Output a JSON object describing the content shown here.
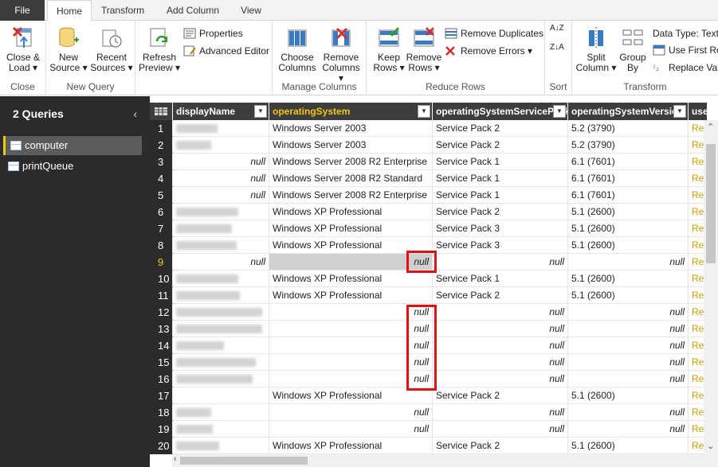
{
  "tabs": [
    "File",
    "Home",
    "Transform",
    "Add Column",
    "View"
  ],
  "ribbon": {
    "close": {
      "close_load": [
        "Close &",
        "Load ▾"
      ],
      "label": "Close"
    },
    "new_query": {
      "new_source": [
        "New",
        "Source ▾"
      ],
      "recent_sources": [
        "Recent",
        "Sources ▾"
      ],
      "label": "New Query"
    },
    "query": {
      "refresh_preview": [
        "Refresh",
        "Preview ▾"
      ],
      "properties": "Properties",
      "advanced_editor": "Advanced Editor"
    },
    "manage_columns": {
      "choose_columns": [
        "Choose",
        "Columns"
      ],
      "remove_columns": [
        "Remove",
        "Columns ▾"
      ],
      "label": "Manage Columns"
    },
    "reduce_rows": {
      "keep_rows": [
        "Keep",
        "Rows ▾"
      ],
      "remove_rows": [
        "Remove",
        "Rows ▾"
      ],
      "remove_duplicates": "Remove Duplicates",
      "remove_errors": "Remove Errors ▾",
      "label": "Reduce Rows"
    },
    "sort": {
      "label": "Sort",
      "asc": "A↓Z",
      "desc": "Z↓A"
    },
    "transform": {
      "split_column": [
        "Split",
        "Column ▾"
      ],
      "group_by": [
        "Group",
        "By"
      ],
      "data_type": "Data Type: Text",
      "use_first_row": "Use First Ro",
      "replace_values": "Replace Val",
      "label": "Transform"
    }
  },
  "queries": {
    "title": "2 Queries",
    "items": [
      "computer",
      "printQueue"
    ],
    "selected": "computer"
  },
  "grid": {
    "columns": [
      "displayName",
      "operatingSystem",
      "operatingSystemServicePack",
      "operatingSystemVersion",
      "user"
    ],
    "highlighted_row": 9,
    "rows": [
      {
        "n": "1",
        "dn": "",
        "os": "Windows Server 2003",
        "sp": "Service Pack 2",
        "ver": "5.2 (3790)",
        "user": "Rec"
      },
      {
        "n": "2",
        "dn": "",
        "os": "Windows Server 2003",
        "sp": "Service Pack 2",
        "ver": "5.2 (3790)",
        "user": "Rec"
      },
      {
        "n": "3",
        "dn": "null",
        "os": "Windows Server 2008 R2 Enterprise",
        "sp": "Service Pack 1",
        "ver": "6.1 (7601)",
        "user": "Rec"
      },
      {
        "n": "4",
        "dn": "null",
        "os": "Windows Server 2008 R2 Standard",
        "sp": "Service Pack 1",
        "ver": "6.1 (7601)",
        "user": "Rec"
      },
      {
        "n": "5",
        "dn": "null",
        "os": "Windows Server 2008 R2 Enterprise",
        "sp": "Service Pack 1",
        "ver": "6.1 (7601)",
        "user": "Rec"
      },
      {
        "n": "6",
        "dn": "",
        "os": "Windows XP Professional",
        "sp": "Service Pack 2",
        "ver": "5.1 (2600)",
        "user": "Rec"
      },
      {
        "n": "7",
        "dn": "",
        "os": "Windows XP Professional",
        "sp": "Service Pack 3",
        "ver": "5.1 (2600)",
        "user": "Rec"
      },
      {
        "n": "8",
        "dn": "",
        "os": "Windows XP Professional",
        "sp": "Service Pack 3",
        "ver": "5.1 (2600)",
        "user": "Rec"
      },
      {
        "n": "9",
        "dn": "null",
        "os": "null",
        "sp": "null",
        "ver": "null",
        "user": "Rec"
      },
      {
        "n": "10",
        "dn": "",
        "os": "Windows XP Professional",
        "sp": "Service Pack 1",
        "ver": "5.1 (2600)",
        "user": "Rec"
      },
      {
        "n": "11",
        "dn": "",
        "os": "Windows XP Professional",
        "sp": "Service Pack 2",
        "ver": "5.1 (2600)",
        "user": "Rec"
      },
      {
        "n": "12",
        "dn": "",
        "os": "null",
        "sp": "null",
        "ver": "null",
        "user": "Rec"
      },
      {
        "n": "13",
        "dn": "",
        "os": "null",
        "sp": "null",
        "ver": "null",
        "user": "Rec"
      },
      {
        "n": "14",
        "dn": "",
        "os": "null",
        "sp": "null",
        "ver": "null",
        "user": "Rec"
      },
      {
        "n": "15",
        "dn": "",
        "os": "null",
        "sp": "null",
        "ver": "null",
        "user": "Rec"
      },
      {
        "n": "16",
        "dn": "",
        "os": "null",
        "sp": "null",
        "ver": "null",
        "user": "Rec"
      },
      {
        "n": "17",
        "dn": "",
        "os": "Windows XP Professional",
        "sp": "Service Pack 2",
        "ver": "5.1 (2600)",
        "user": "Rec"
      },
      {
        "n": "18",
        "dn": "",
        "os": "null",
        "sp": "null",
        "ver": "null",
        "user": "Rec"
      },
      {
        "n": "19",
        "dn": "",
        "os": "null",
        "sp": "null",
        "ver": "null",
        "user": "Rec"
      },
      {
        "n": "20",
        "dn": "",
        "os": "Windows XP Professional",
        "sp": "Service Pack 2",
        "ver": "5.1 (2600)",
        "user": "Rec"
      }
    ]
  },
  "colors": {
    "accent": "#f2c811",
    "dark": "#2b2b2b",
    "annotation": "#e01010"
  }
}
